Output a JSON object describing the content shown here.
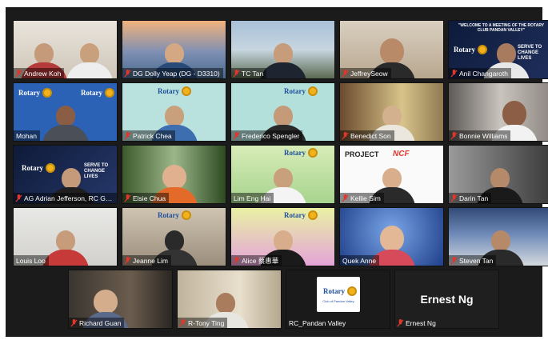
{
  "participants": [
    {
      "name": "Andrew Koh"
    },
    {
      "name": "DG Dolly Yeap (DG - D3310)"
    },
    {
      "name": "TC Tan"
    },
    {
      "name": "JeffreySeow"
    },
    {
      "name": "Anil Changaroth"
    },
    {
      "name": "Mohan"
    },
    {
      "name": "Patrick Chea"
    },
    {
      "name": "Frederico Spengler"
    },
    {
      "name": "Benedict Son"
    },
    {
      "name": "Bonnie Williams"
    },
    {
      "name": "AG Adrian Jefferson, RC Gar..."
    },
    {
      "name": "Elsie Chua"
    },
    {
      "name": "Lim Eng Hai"
    },
    {
      "name": "Kellie Sim"
    },
    {
      "name": "Darin Tan"
    },
    {
      "name": "Louis Loo"
    },
    {
      "name": "Jeanne Lim"
    },
    {
      "name": "Alice 蔡惠華"
    },
    {
      "name": "Quek Anne"
    },
    {
      "name": "Steven Tan"
    },
    {
      "name": "Richard Guan"
    },
    {
      "name": "R-Tony Ting"
    },
    {
      "name": "RC_Pandan Valley"
    },
    {
      "name": "Ernest Ng"
    }
  ],
  "overlays": {
    "anil_banner": "\"WELCOME TO A MEETING OF THE ROTARY CLUB PANDAN VALLEY\"",
    "rotary_word": "Rotary",
    "serve": "SERVE TO",
    "change": "CHANGE LIVES",
    "project": "PROJECT",
    "ncf": "NCF",
    "club": "Club of Pandan Valley",
    "ernest_big": "Ernest Ng"
  },
  "colors": {
    "mic_muted": "#e0362b",
    "rotary_blue": "#1d4e9a",
    "rotary_gold": "#f1b21c"
  }
}
